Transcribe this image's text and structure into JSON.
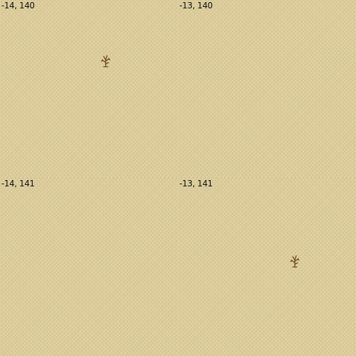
{
  "tiles": [
    {
      "label": "-14, 140",
      "has_shrub": true
    },
    {
      "label": "-13, 140",
      "has_shrub": false
    },
    {
      "label": "-14, 141",
      "has_shrub": false
    },
    {
      "label": "-13, 141",
      "has_shrub": true
    }
  ],
  "colors": {
    "sand": "#dccc9b",
    "shrub": "#6b4a1f",
    "label": "#111111"
  },
  "icons": {
    "shrub": "dead-shrub-icon"
  }
}
